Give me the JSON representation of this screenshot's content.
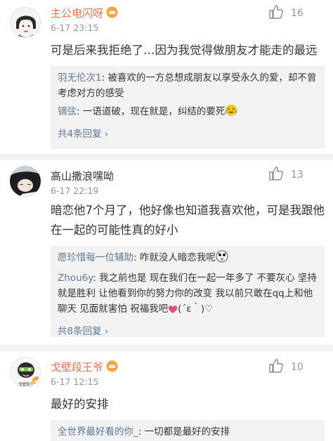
{
  "comments": [
    {
      "username": "主公电闪呀",
      "time": "6-17 23:15",
      "likes": "16",
      "text": "可是后来我拒绝了…因为我觉得做朋友才能走的最远",
      "replies": [
        {
          "name": "羽无伦次1",
          "text": "被喜欢的一方总想成朋友以享受永久的爱，却不曾考虑对方的感受"
        },
        {
          "name": "镝弦",
          "text": "一语道破，现在就是，纠结的要死"
        }
      ],
      "more": "共4条回复"
    },
    {
      "username": "高山撒浪嘿呦",
      "time": "6-17 22:19",
      "likes": "13",
      "text": "暗恋他7个月了，他好像也知道我喜欢他，可是我跟他在一起的可能性真的好小",
      "replies": [
        {
          "name": "愿珍惜每一位辅助",
          "text": "咋就没人暗恋我呢"
        },
        {
          "name": "Zhou6y",
          "text": "我之前也是  现在我们在一起一年多了 不要灰心 坚持就是胜利  让他看到你的努力你的改变 我以前只敢在qq上和他聊天  见面就害怕 祝福我吧",
          "tail": "(´ε｀)♡"
        }
      ],
      "more": "共8条回复"
    },
    {
      "username": "戈壁段王爷",
      "time": "6-17 12:15",
      "likes": "10",
      "text": "最好的安排",
      "avatar_text": "戈壁段王",
      "replies": [
        {
          "name": "全世界最好看的你_",
          "text": "一切都是最好的安排"
        }
      ]
    }
  ],
  "colors": {
    "orange": "#eb7350",
    "link": "#5d7895",
    "gray": "#939393",
    "reply_bg": "#f2f2f2"
  },
  "icons": [
    "thumbs-up-icon",
    "vip-crown-icon",
    "chevron-right-icon",
    "laughing-crying-emoji",
    "heart-emoji",
    "surprised-face-emoji"
  ]
}
